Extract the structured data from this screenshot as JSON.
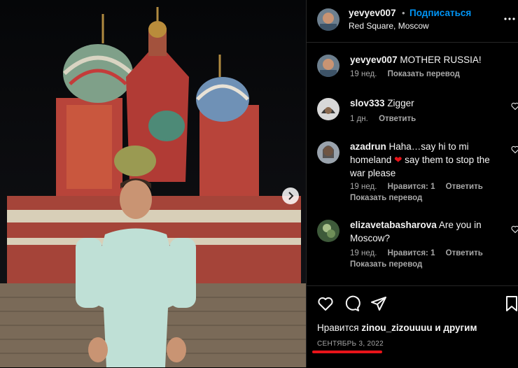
{
  "post": {
    "author": "yevyev007",
    "follow_label": "Подписаться",
    "location": "Red Square, Moscow",
    "caption": "MOTHER RUSSIA!",
    "caption_time": "19 нед.",
    "caption_translate": "Показать перевод"
  },
  "comments": [
    {
      "user": "slov333",
      "text": "Zigger",
      "time": "1 дн.",
      "likes": "",
      "reply": "Ответить",
      "translate": ""
    },
    {
      "user": "azadrun",
      "text_a": "Haha…say hi to mi homeland",
      "text_b": "say them to stop the war please",
      "time": "19 нед.",
      "likes": "Нравится: 1",
      "reply": "Ответить",
      "translate": "Показать перевод"
    },
    {
      "user": "elizavetabasharova",
      "text": "Are you in Moscow?",
      "time": "19 нед.",
      "likes": "Нравится: 1",
      "reply": "Ответить",
      "translate": "Показать перевод"
    }
  ],
  "likes_line": {
    "prefix": "Нравится",
    "user": "zinou_zizouuuu",
    "suffix": "и другим"
  },
  "date": "СЕНТЯБРЬ 3, 2022",
  "icons": [
    "heart-icon",
    "comment-icon",
    "share-icon",
    "bookmark-icon",
    "more-icon",
    "chevron-right-icon"
  ],
  "colors": {
    "link": "#0095f6",
    "annotation": "#e8141a",
    "secondary_text": "#a8a8a8"
  }
}
